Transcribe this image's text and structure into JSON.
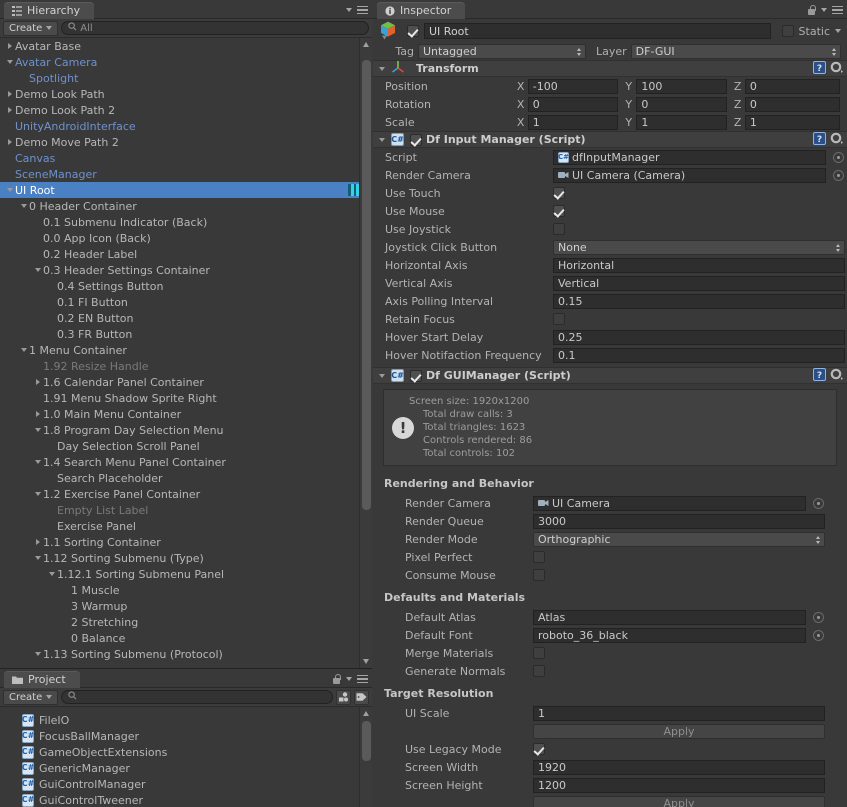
{
  "hierarchy": {
    "tab_label": "Hierarchy",
    "tab_icon": "hierarchy-icon",
    "create_label": "Create",
    "search_placeholder": "All",
    "search_value": "All",
    "items": [
      {
        "label": "Avatar Base",
        "indent": 0,
        "arrow": "right",
        "color": "normal"
      },
      {
        "label": "Avatar Camera",
        "indent": 0,
        "arrow": "down",
        "color": "blue"
      },
      {
        "label": "Spotlight",
        "indent": 1,
        "arrow": "none",
        "color": "blue"
      },
      {
        "label": "Demo Look Path",
        "indent": 0,
        "arrow": "right",
        "color": "normal"
      },
      {
        "label": "Demo Look Path 2",
        "indent": 0,
        "arrow": "right",
        "color": "normal"
      },
      {
        "label": "UnityAndroidInterface",
        "indent": 0,
        "arrow": "none",
        "color": "blue"
      },
      {
        "label": "Demo Move Path 2",
        "indent": 0,
        "arrow": "right",
        "color": "normal"
      },
      {
        "label": "Canvas",
        "indent": 0,
        "arrow": "none",
        "color": "blue"
      },
      {
        "label": "SceneManager",
        "indent": 0,
        "arrow": "none",
        "color": "blue"
      },
      {
        "label": "UI Root",
        "indent": 0,
        "arrow": "down",
        "color": "normal",
        "selected": true,
        "badge": "df-prefab-icon"
      },
      {
        "label": "0 Header Container",
        "indent": 1,
        "arrow": "down",
        "color": "normal"
      },
      {
        "label": "0.1 Submenu Indicator (Back)",
        "indent": 2,
        "arrow": "none",
        "color": "normal"
      },
      {
        "label": "0.0 App Icon (Back)",
        "indent": 2,
        "arrow": "none",
        "color": "normal"
      },
      {
        "label": "0.2 Header Label",
        "indent": 2,
        "arrow": "none",
        "color": "normal"
      },
      {
        "label": "0.3 Header Settings Container",
        "indent": 2,
        "arrow": "down",
        "color": "normal"
      },
      {
        "label": "0.4 Settings Button",
        "indent": 3,
        "arrow": "none",
        "color": "normal"
      },
      {
        "label": "0.1 FI Button",
        "indent": 3,
        "arrow": "none",
        "color": "normal"
      },
      {
        "label": "0.2 EN Button",
        "indent": 3,
        "arrow": "none",
        "color": "normal"
      },
      {
        "label": "0.3 FR Button",
        "indent": 3,
        "arrow": "none",
        "color": "normal"
      },
      {
        "label": "1 Menu Container",
        "indent": 1,
        "arrow": "down",
        "color": "normal"
      },
      {
        "label": "1.92 Resize Handle",
        "indent": 2,
        "arrow": "none",
        "color": "dim"
      },
      {
        "label": "1.6 Calendar Panel Container",
        "indent": 2,
        "arrow": "right",
        "color": "normal"
      },
      {
        "label": "1.91 Menu Shadow Sprite Right",
        "indent": 2,
        "arrow": "none",
        "color": "normal"
      },
      {
        "label": "1.0 Main Menu Container",
        "indent": 2,
        "arrow": "right",
        "color": "normal"
      },
      {
        "label": "1.8 Program Day Selection Menu",
        "indent": 2,
        "arrow": "down",
        "color": "normal"
      },
      {
        "label": "Day Selection Scroll Panel",
        "indent": 3,
        "arrow": "none",
        "color": "normal"
      },
      {
        "label": "1.4 Search Menu Panel Container",
        "indent": 2,
        "arrow": "down",
        "color": "normal"
      },
      {
        "label": "Search Placeholder",
        "indent": 3,
        "arrow": "none",
        "color": "normal"
      },
      {
        "label": "1.2 Exercise Panel Container",
        "indent": 2,
        "arrow": "down",
        "color": "normal"
      },
      {
        "label": "Empty List Label",
        "indent": 3,
        "arrow": "none",
        "color": "dim"
      },
      {
        "label": "Exercise Panel",
        "indent": 3,
        "arrow": "none",
        "color": "normal"
      },
      {
        "label": "1.1 Sorting Container",
        "indent": 2,
        "arrow": "right",
        "color": "normal"
      },
      {
        "label": "1.12 Sorting Submenu (Type)",
        "indent": 2,
        "arrow": "down",
        "color": "normal"
      },
      {
        "label": "1.12.1 Sorting Submenu Panel",
        "indent": 3,
        "arrow": "down",
        "color": "normal"
      },
      {
        "label": "1 Muscle",
        "indent": 4,
        "arrow": "none",
        "color": "normal"
      },
      {
        "label": "3 Warmup",
        "indent": 4,
        "arrow": "none",
        "color": "normal"
      },
      {
        "label": "2 Stretching",
        "indent": 4,
        "arrow": "none",
        "color": "normal"
      },
      {
        "label": "0 Balance",
        "indent": 4,
        "arrow": "none",
        "color": "normal"
      },
      {
        "label": "1.13 Sorting Submenu (Protocol)",
        "indent": 2,
        "arrow": "down",
        "color": "normal"
      }
    ]
  },
  "project": {
    "tab_label": "Project",
    "tab_icon": "folder-icon",
    "create_label": "Create",
    "search_placeholder": "",
    "toolbar_icons": [
      "filter-by-type-icon",
      "filter-by-label-icon"
    ],
    "assets": [
      {
        "label": "FileIO",
        "icon": "csharp-script-icon"
      },
      {
        "label": "FocusBallManager",
        "icon": "csharp-script-icon"
      },
      {
        "label": "GameObjectExtensions",
        "icon": "csharp-script-icon"
      },
      {
        "label": "GenericManager",
        "icon": "csharp-script-icon"
      },
      {
        "label": "GuiControlManager",
        "icon": "csharp-script-icon"
      },
      {
        "label": "GuiControlTweener",
        "icon": "csharp-script-icon"
      }
    ]
  },
  "inspector": {
    "tab_label": "Inspector",
    "tab_icon": "info-icon",
    "object": {
      "enabled": true,
      "name": "UI Root",
      "static_label": "Static",
      "static_checked": false,
      "tag_label": "Tag",
      "tag_value": "Untagged",
      "layer_label": "Layer",
      "layer_value": "DF-GUI"
    },
    "transform": {
      "title": "Transform",
      "icon": "transform-gizmo-icon",
      "rows": [
        {
          "name": "Position",
          "x": "-100",
          "y": "100",
          "z": "0"
        },
        {
          "name": "Rotation",
          "x": "0",
          "y": "0",
          "z": "0"
        },
        {
          "name": "Scale",
          "x": "1",
          "y": "1",
          "z": "1"
        }
      ],
      "axis_labels": [
        "X",
        "Y",
        "Z"
      ]
    },
    "input_manager": {
      "title": "Df Input Manager (Script)",
      "enabled": true,
      "fields": [
        {
          "name": "Script",
          "type": "object",
          "value": "dfInputManager",
          "icon": "csharp-script-icon"
        },
        {
          "name": "Render Camera",
          "type": "object",
          "value": "UI Camera (Camera)",
          "icon": "camera-icon"
        },
        {
          "name": "Use Touch",
          "type": "checkbox",
          "value": true
        },
        {
          "name": "Use Mouse",
          "type": "checkbox",
          "value": true
        },
        {
          "name": "Use Joystick",
          "type": "checkbox",
          "value": false
        },
        {
          "name": "Joystick Click Button",
          "type": "dropdown",
          "value": "None"
        },
        {
          "name": "Horizontal Axis",
          "type": "text",
          "value": "Horizontal"
        },
        {
          "name": "Vertical Axis",
          "type": "text",
          "value": "Vertical"
        },
        {
          "name": "Axis Polling Interval",
          "type": "text",
          "value": "0.15"
        },
        {
          "name": "Retain Focus",
          "type": "checkbox",
          "value": false
        },
        {
          "name": "Hover Start Delay",
          "type": "text",
          "value": "0.25"
        },
        {
          "name": "Hover Notifaction Frequency",
          "type": "text",
          "value": "0.1"
        }
      ]
    },
    "gui_manager": {
      "title": "Df GUIManager (Script)",
      "enabled": true,
      "helpbox": {
        "icon": "warning-icon",
        "lines": [
          "Screen size: 1920x1200",
          "Total draw calls: 3",
          "Total triangles: 1623",
          "Controls rendered: 86",
          "Total controls: 102"
        ]
      },
      "sections": [
        {
          "title": "Rendering and Behavior",
          "fields": [
            {
              "name": "Render Camera",
              "type": "object",
              "value": "UI Camera",
              "icon": "camera-icon"
            },
            {
              "name": "Render Queue",
              "type": "text",
              "value": "3000"
            },
            {
              "name": "Render Mode",
              "type": "dropdown",
              "value": "Orthographic"
            },
            {
              "name": "Pixel Perfect",
              "type": "checkbox",
              "value": false
            },
            {
              "name": "Consume Mouse",
              "type": "checkbox",
              "value": false
            }
          ]
        },
        {
          "title": "Defaults and Materials",
          "fields": [
            {
              "name": "Default Atlas",
              "type": "object",
              "value": "Atlas"
            },
            {
              "name": "Default Font",
              "type": "object",
              "value": "roboto_36_black"
            },
            {
              "name": "Merge Materials",
              "type": "checkbox",
              "value": false
            },
            {
              "name": "Generate Normals",
              "type": "checkbox",
              "value": false
            }
          ]
        },
        {
          "title": "Target Resolution",
          "fields": [
            {
              "name": "UI Scale",
              "type": "text",
              "value": "1"
            },
            {
              "name": "",
              "type": "button",
              "value": "Apply"
            },
            {
              "name": "Use Legacy Mode",
              "type": "checkbox",
              "value": true
            },
            {
              "name": "Screen Width",
              "type": "text",
              "value": "1920"
            },
            {
              "name": "Screen Height",
              "type": "text",
              "value": "1200"
            },
            {
              "name": "",
              "type": "button",
              "value": "Apply"
            }
          ]
        }
      ]
    }
  },
  "colors": {
    "selection_blue": "#4981c4",
    "panel_bg": "#393939",
    "link_blue": "#6f92cc"
  }
}
